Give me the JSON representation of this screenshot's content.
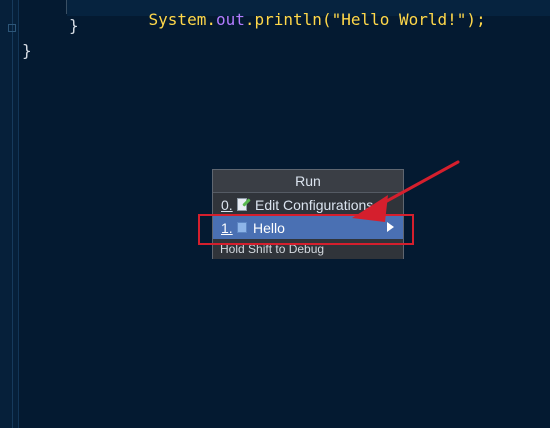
{
  "editor": {
    "code": {
      "line1": {
        "prefix": "System.",
        "out": "out",
        "suffix": ".println(\"Hello World!\");"
      },
      "close_brace_inner": "}",
      "close_brace_outer": "}"
    }
  },
  "popup": {
    "title": "Run",
    "items": [
      {
        "mnemonic": "0.",
        "label": "Edit Configurations...",
        "icon": "edit-configurations-icon"
      },
      {
        "mnemonic": "1.",
        "label": "Hello",
        "icon": "class-icon"
      }
    ],
    "hint": "Hold Shift to Debug"
  },
  "colors": {
    "editor_bg": "#041a31",
    "popup_bg": "#2e3137",
    "selected_item": "#4a70b3",
    "highlight_red": "#d51f2d"
  }
}
